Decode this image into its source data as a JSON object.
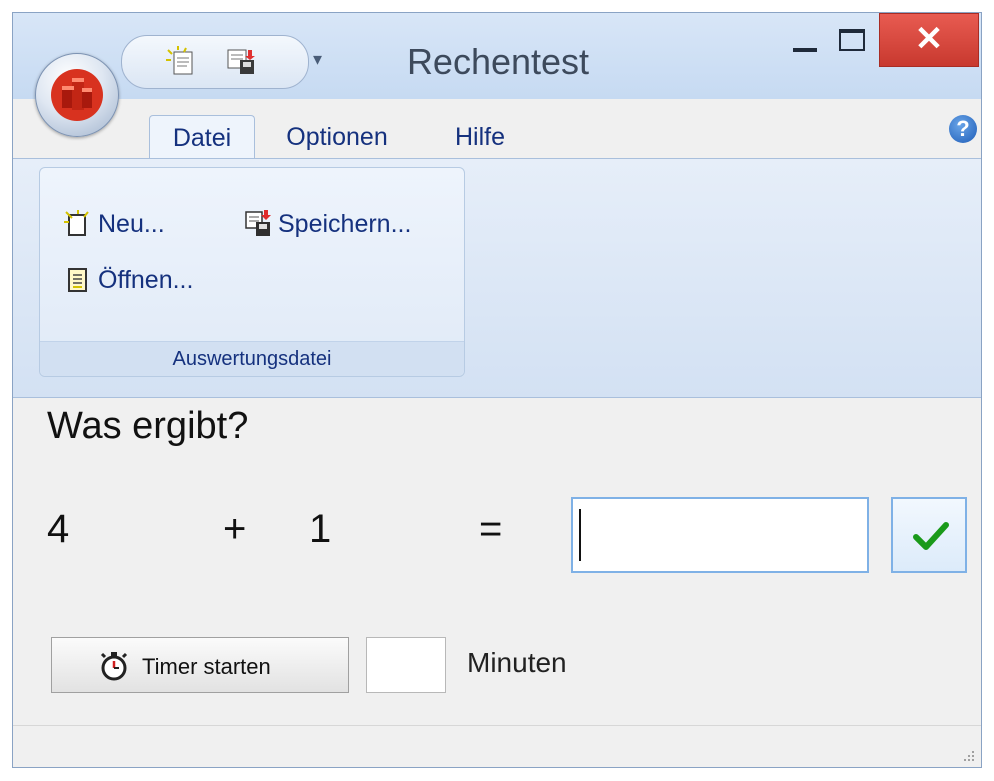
{
  "window": {
    "title": "Rechentest",
    "close_glyph": "✕"
  },
  "app_icon": "app-cubes-icon",
  "quick_access": [
    "new-document-icon",
    "save-icon"
  ],
  "quick_access_dropdown": "▾",
  "tabs": [
    {
      "label": "Datei",
      "active": true
    },
    {
      "label": "Optionen",
      "active": false
    },
    {
      "label": "Hilfe",
      "active": false
    }
  ],
  "help_glyph": "?",
  "ribbon": {
    "group_label": "Auswertungsdatei",
    "buttons": {
      "new": "Neu...",
      "save": "Speichern...",
      "open": "Öffnen..."
    }
  },
  "question": "Was ergibt?",
  "equation": {
    "operand1": "4",
    "operator": "+",
    "operand2": "1",
    "equals": "="
  },
  "answer_value": "",
  "timer": {
    "button_label": "Timer starten",
    "minutes_value": "",
    "minutes_label": "Minuten"
  },
  "colors": {
    "accent_blue": "#15317e",
    "close_red": "#c8392f",
    "check_green": "#1a9a1a",
    "input_border": "#7fb1e6"
  }
}
